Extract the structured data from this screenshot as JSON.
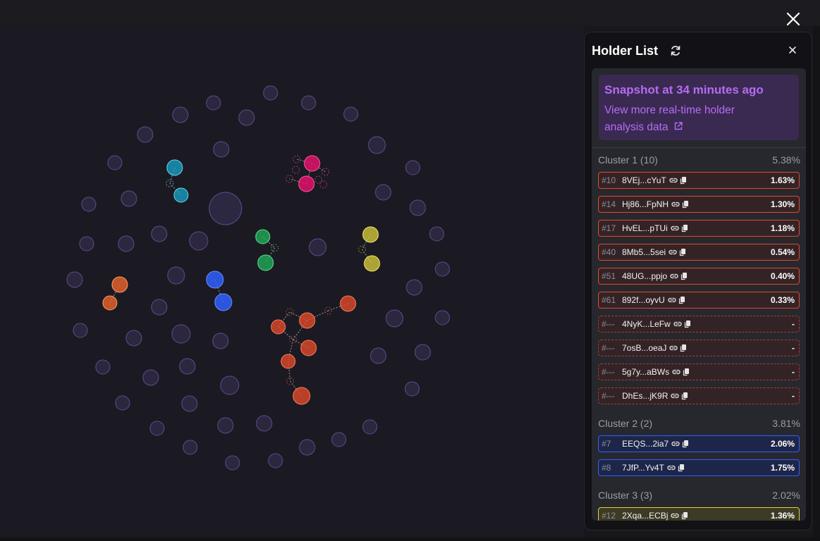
{
  "panel": {
    "title": "Holder List",
    "snapshot_title": "Snapshot at 34 minutes ago",
    "snapshot_link_line1": "View more real-time holder",
    "snapshot_link_line2": "analysis data"
  },
  "clusters": [
    {
      "label": "Cluster 1 (10)",
      "percent": "5.38%",
      "color": "red",
      "holders": [
        {
          "rank": "#10",
          "address": "8VEj...cYuT",
          "percent": "1.63%"
        },
        {
          "rank": "#14",
          "address": "Hj86...FpNH",
          "percent": "1.30%"
        },
        {
          "rank": "#17",
          "address": "HvEL...pTUi",
          "percent": "1.18%"
        },
        {
          "rank": "#40",
          "address": "8Mb5...5sei",
          "percent": "0.54%"
        },
        {
          "rank": "#51",
          "address": "48UG...ppjo",
          "percent": "0.40%"
        },
        {
          "rank": "#61",
          "address": "892f...oyvU",
          "percent": "0.33%"
        },
        {
          "rank": "#---",
          "address": "4NyK...LeFw",
          "percent": "-"
        },
        {
          "rank": "#---",
          "address": "7osB...oeaJ",
          "percent": "-"
        },
        {
          "rank": "#---",
          "address": "5g7y...aBWs",
          "percent": "-"
        },
        {
          "rank": "#---",
          "address": "DhEs...jK9R",
          "percent": "-"
        }
      ]
    },
    {
      "label": "Cluster 2 (2)",
      "percent": "3.81%",
      "color": "blue",
      "holders": [
        {
          "rank": "#7",
          "address": "EEQS...2ia7",
          "percent": "2.06%"
        },
        {
          "rank": "#8",
          "address": "7JfP...Yv4T",
          "percent": "1.75%"
        }
      ]
    },
    {
      "label": "Cluster 3 (3)",
      "percent": "2.02%",
      "color": "yellow",
      "holders": [
        {
          "rank": "#12",
          "address": "2Xqa...ECBj",
          "percent": "1.36%"
        }
      ]
    }
  ],
  "colors": {
    "cluster_red": "#e04a2a",
    "cluster_blue": "#2f60ff",
    "cluster_yellow": "#ddd23e",
    "cluster_pink": "#e0126a",
    "cluster_cyan": "#1aa6cc",
    "cluster_green": "#1faa5a",
    "cluster_orange": "#e0622a",
    "accent_purple": "#b56cf2",
    "unclustered_node": "#3a3258"
  },
  "icons": {
    "window_close": "close-icon",
    "refresh": "refresh-icon",
    "panel_close": "close-icon",
    "external": "external-link-icon",
    "link": "link-icon",
    "copy": "copy-icon"
  }
}
